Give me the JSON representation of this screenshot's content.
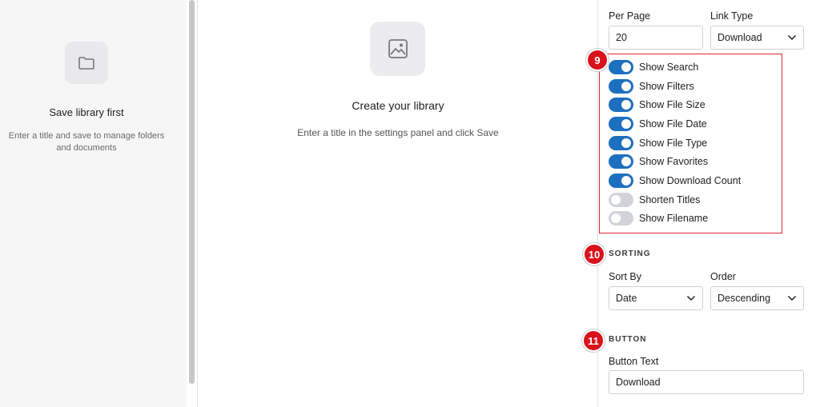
{
  "left_panel": {
    "icon": "folder-icon",
    "title": "Save library first",
    "description": "Enter a title and save to manage folders and documents"
  },
  "center": {
    "icon": "image-icon",
    "title": "Create your library",
    "description": "Enter a title in the settings panel and click Save"
  },
  "settings": {
    "per_page": {
      "label": "Per Page",
      "value": "20"
    },
    "link_type": {
      "label": "Link Type",
      "value": "Download"
    },
    "toggles_badge": "9",
    "toggles": [
      {
        "label": "Show Search",
        "on": true
      },
      {
        "label": "Show Filters",
        "on": true
      },
      {
        "label": "Show File Size",
        "on": true
      },
      {
        "label": "Show File Date",
        "on": true
      },
      {
        "label": "Show File Type",
        "on": true
      },
      {
        "label": "Show Favorites",
        "on": true
      },
      {
        "label": "Show Download Count",
        "on": true
      },
      {
        "label": "Shorten Titles",
        "on": false
      },
      {
        "label": "Show Filename",
        "on": false
      }
    ],
    "sorting": {
      "badge": "10",
      "heading": "SORTING",
      "sort_by": {
        "label": "Sort By",
        "value": "Date"
      },
      "order": {
        "label": "Order",
        "value": "Descending"
      }
    },
    "button": {
      "badge": "11",
      "heading": "BUTTON",
      "text_label": "Button Text",
      "text_value": "Download"
    }
  },
  "colors": {
    "toggle_on": "#1d6fbf",
    "toggle_off": "#d0d3d8",
    "highlight": "#e0282e",
    "badge": "#d8131b"
  }
}
